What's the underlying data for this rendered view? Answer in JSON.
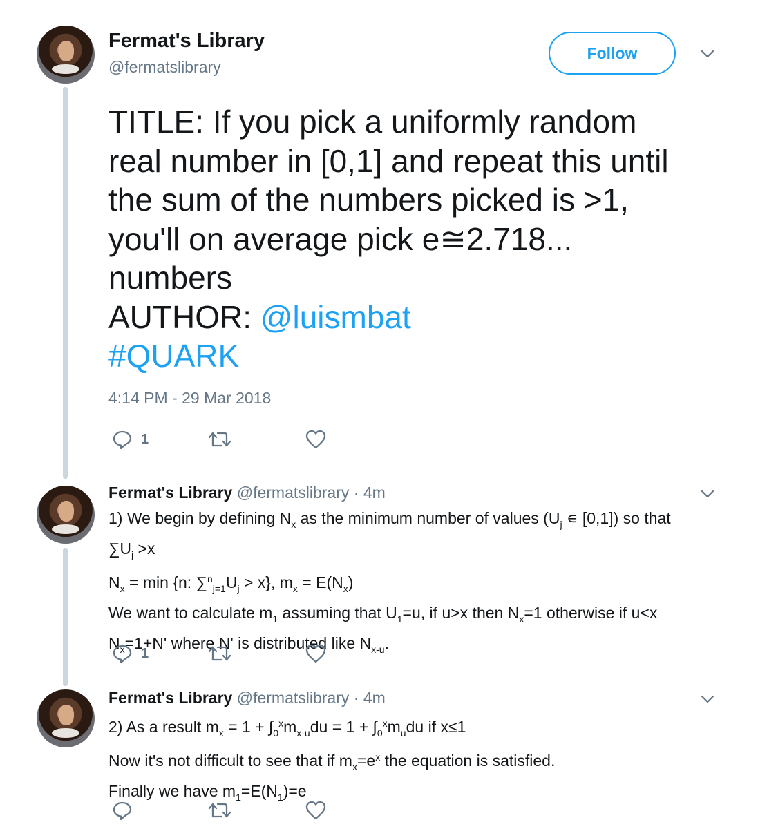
{
  "author": {
    "name": "Fermat's Library",
    "handle": "@fermatslibrary"
  },
  "follow_label": "Follow",
  "main_tweet": {
    "line1": "TITLE: If you pick a uniformly random",
    "line2": "real number in [0,1] and repeat this until",
    "line3": "the sum of the numbers picked is >1,",
    "line4": "you'll on average pick e≅2.718...",
    "line5": "numbers",
    "author_label": "AUTHOR: ",
    "author_mention": "@luismbat",
    "hashtag": "#QUARK",
    "timestamp": "4:14 PM - 29 Mar 2018",
    "reply_count": "1"
  },
  "replies": [
    {
      "name": "Fermat's Library",
      "handle": "@fermatslibrary",
      "time": "· 4m",
      "reply_count": "1"
    },
    {
      "name": "Fermat's Library",
      "handle": "@fermatslibrary",
      "time": "· 4m",
      "reply_count": ""
    }
  ],
  "colors": {
    "accent": "#1da1f2",
    "muted": "#657786",
    "thread_line": "#ccd6dd",
    "text": "#14171a"
  },
  "icons": [
    "reply-icon",
    "retweet-icon",
    "like-icon",
    "chevron-down-icon"
  ]
}
